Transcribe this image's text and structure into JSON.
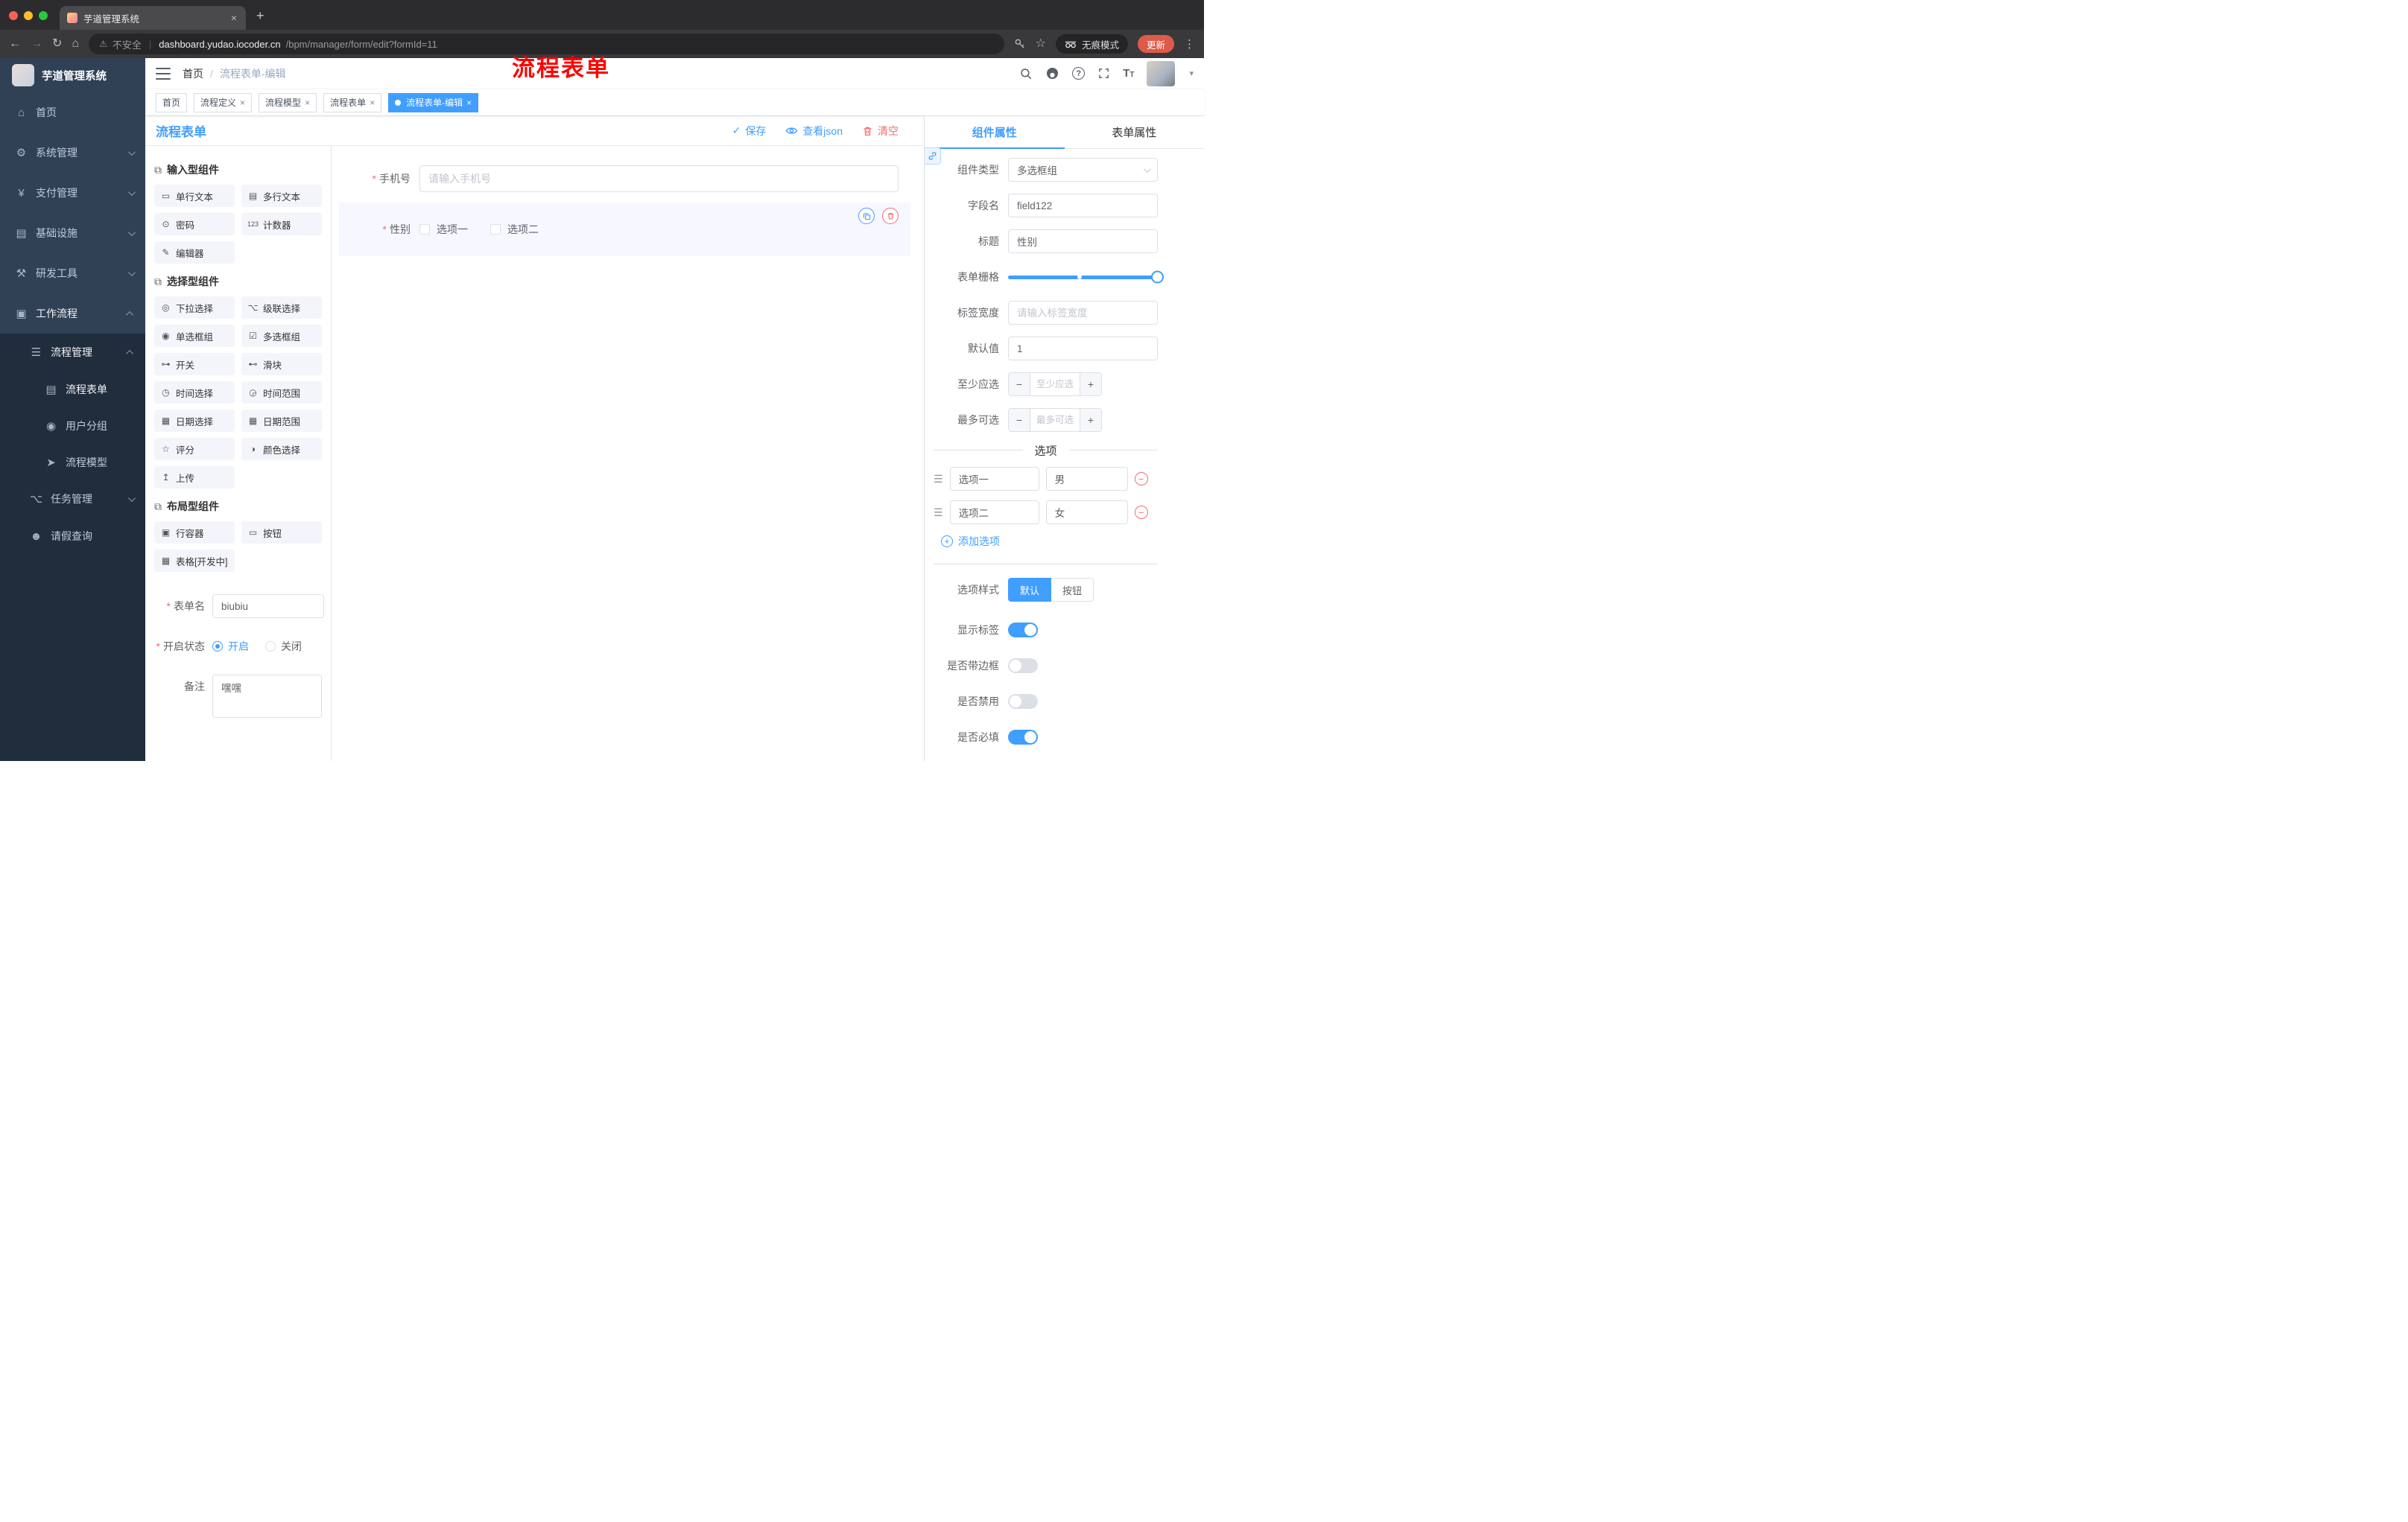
{
  "colors": {
    "accent": "#409EFF",
    "danger": "#F56C6C",
    "annotation_red": "#FE0000",
    "update_pill": "#DE5B49",
    "sidebar_bg": "#304156",
    "submenu_bg": "#1F2D3D"
  },
  "icons": {
    "close": "×",
    "new_tab": "+",
    "menu_dots": "⋮",
    "back": "←",
    "forward": "→",
    "reload": "↻",
    "home": "⌂",
    "star": "☆",
    "warning": "⚠",
    "check": "✓",
    "minus": "−",
    "plus": "+",
    "question": "?",
    "caret_down": "▾",
    "divider_bar": "|",
    "font_big": "T",
    "font_small": "T"
  },
  "browser": {
    "tab_title": "芋道管理系统",
    "security": "不安全",
    "host": "dashboard.yudao.iocoder.cn",
    "path": "/bpm/manager/form/edit?formId=11",
    "incognito": "无痕模式",
    "update": "更新"
  },
  "sidebar": {
    "logo": "芋道管理系统",
    "items": [
      {
        "label": "首页",
        "glyph": "⌂"
      },
      {
        "label": "系统管理",
        "glyph": "⚙"
      },
      {
        "label": "支付管理",
        "glyph": "¥"
      },
      {
        "label": "基础设施",
        "glyph": "▤"
      },
      {
        "label": "研发工具",
        "glyph": "⚒"
      },
      {
        "label": "工作流程",
        "glyph": "▣"
      },
      {
        "label": "流程管理",
        "glyph": "☰"
      },
      {
        "label": "流程表单",
        "glyph": "▤"
      },
      {
        "label": "用户分组",
        "glyph": "◉"
      },
      {
        "label": "流程模型",
        "glyph": "➤"
      },
      {
        "label": "任务管理",
        "glyph": "⌥"
      },
      {
        "label": "请假查询",
        "glyph": "☻"
      }
    ]
  },
  "header": {
    "breadcrumb_home": "首页",
    "breadcrumb_sep": "/",
    "breadcrumb_current": "流程表单-编辑",
    "annotation": "流程表单"
  },
  "tags": [
    {
      "label": "首页"
    },
    {
      "label": "流程定义"
    },
    {
      "label": "流程模型"
    },
    {
      "label": "流程表单"
    },
    {
      "label": "流程表单-编辑"
    }
  ],
  "designer": {
    "title": "流程表单",
    "save": "保存",
    "view_json": "查看json",
    "clear": "清空",
    "library": {
      "sections": [
        {
          "title": "输入型组件",
          "glyph": "⧉",
          "items": [
            {
              "label": "单行文本",
              "glyph": "▭"
            },
            {
              "label": "多行文本",
              "glyph": "▤"
            },
            {
              "label": "密码",
              "glyph": "⊙"
            },
            {
              "label": "计数器",
              "glyph": "123"
            },
            {
              "label": "编辑器",
              "glyph": "✎"
            }
          ]
        },
        {
          "title": "选择型组件",
          "glyph": "⧉",
          "items": [
            {
              "label": "下拉选择",
              "glyph": "◎"
            },
            {
              "label": "级联选择",
              "glyph": "⌥"
            },
            {
              "label": "单选框组",
              "glyph": "◉"
            },
            {
              "label": "多选框组",
              "glyph": "☑"
            },
            {
              "label": "开关",
              "glyph": "⊶"
            },
            {
              "label": "滑块",
              "glyph": "⊷"
            },
            {
              "label": "时间选择",
              "glyph": "◷"
            },
            {
              "label": "时间范围",
              "glyph": "◶"
            },
            {
              "label": "日期选择",
              "glyph": "▦"
            },
            {
              "label": "日期范围",
              "glyph": "▦"
            },
            {
              "label": "评分",
              "glyph": "☆"
            },
            {
              "label": "颜色选择",
              "glyph": "◑"
            },
            {
              "label": "上传",
              "glyph": "↥"
            }
          ]
        },
        {
          "title": "布局型组件",
          "glyph": "⧉",
          "items": [
            {
              "label": "行容器",
              "glyph": "▣"
            },
            {
              "label": "按钮",
              "glyph": "▭"
            },
            {
              "label": "表格[开发中]",
              "glyph": "▦"
            }
          ]
        }
      ]
    },
    "meta": {
      "name_label": "表单名",
      "name_value": "biubiu",
      "status_label": "开启状态",
      "status_on": "开启",
      "status_off": "关闭",
      "status_selected": "开启",
      "remark_label": "备注",
      "remark_value": "嘿嘿"
    },
    "canvas": {
      "phone": {
        "label": "手机号",
        "placeholder": "请输入手机号",
        "required": true
      },
      "gender": {
        "label": "性别",
        "required": true,
        "selected": true,
        "options": [
          "选项一",
          "选项二"
        ]
      }
    },
    "props": {
      "tab_component": "组件属性",
      "tab_form": "表单属性",
      "active_tab": "组件属性",
      "rows": {
        "type_label": "组件类型",
        "type_value": "多选框组",
        "field_label": "字段名",
        "field_value": "field122",
        "title_label": "标题",
        "title_value": "性别",
        "grid_label": "表单栅格",
        "label_width_label": "标签宽度",
        "label_width_placeholder": "请输入标签宽度",
        "default_label": "默认值",
        "default_value": "1",
        "min_label": "至少应选",
        "min_placeholder": "至少应选",
        "max_label": "最多可选",
        "max_placeholder": "最多可选"
      },
      "options_title": "选项",
      "options": [
        {
          "label": "选项一",
          "value": "男"
        },
        {
          "label": "选项二",
          "value": "女"
        }
      ],
      "add_option": "添加选项",
      "style_label": "选项样式",
      "style_options": [
        "默认",
        "按钮"
      ],
      "style_selected": "默认",
      "switches": [
        {
          "label": "显示标签",
          "on": true
        },
        {
          "label": "是否带边框",
          "on": false
        },
        {
          "label": "是否禁用",
          "on": false
        },
        {
          "label": "是否必填",
          "on": true
        }
      ]
    }
  }
}
